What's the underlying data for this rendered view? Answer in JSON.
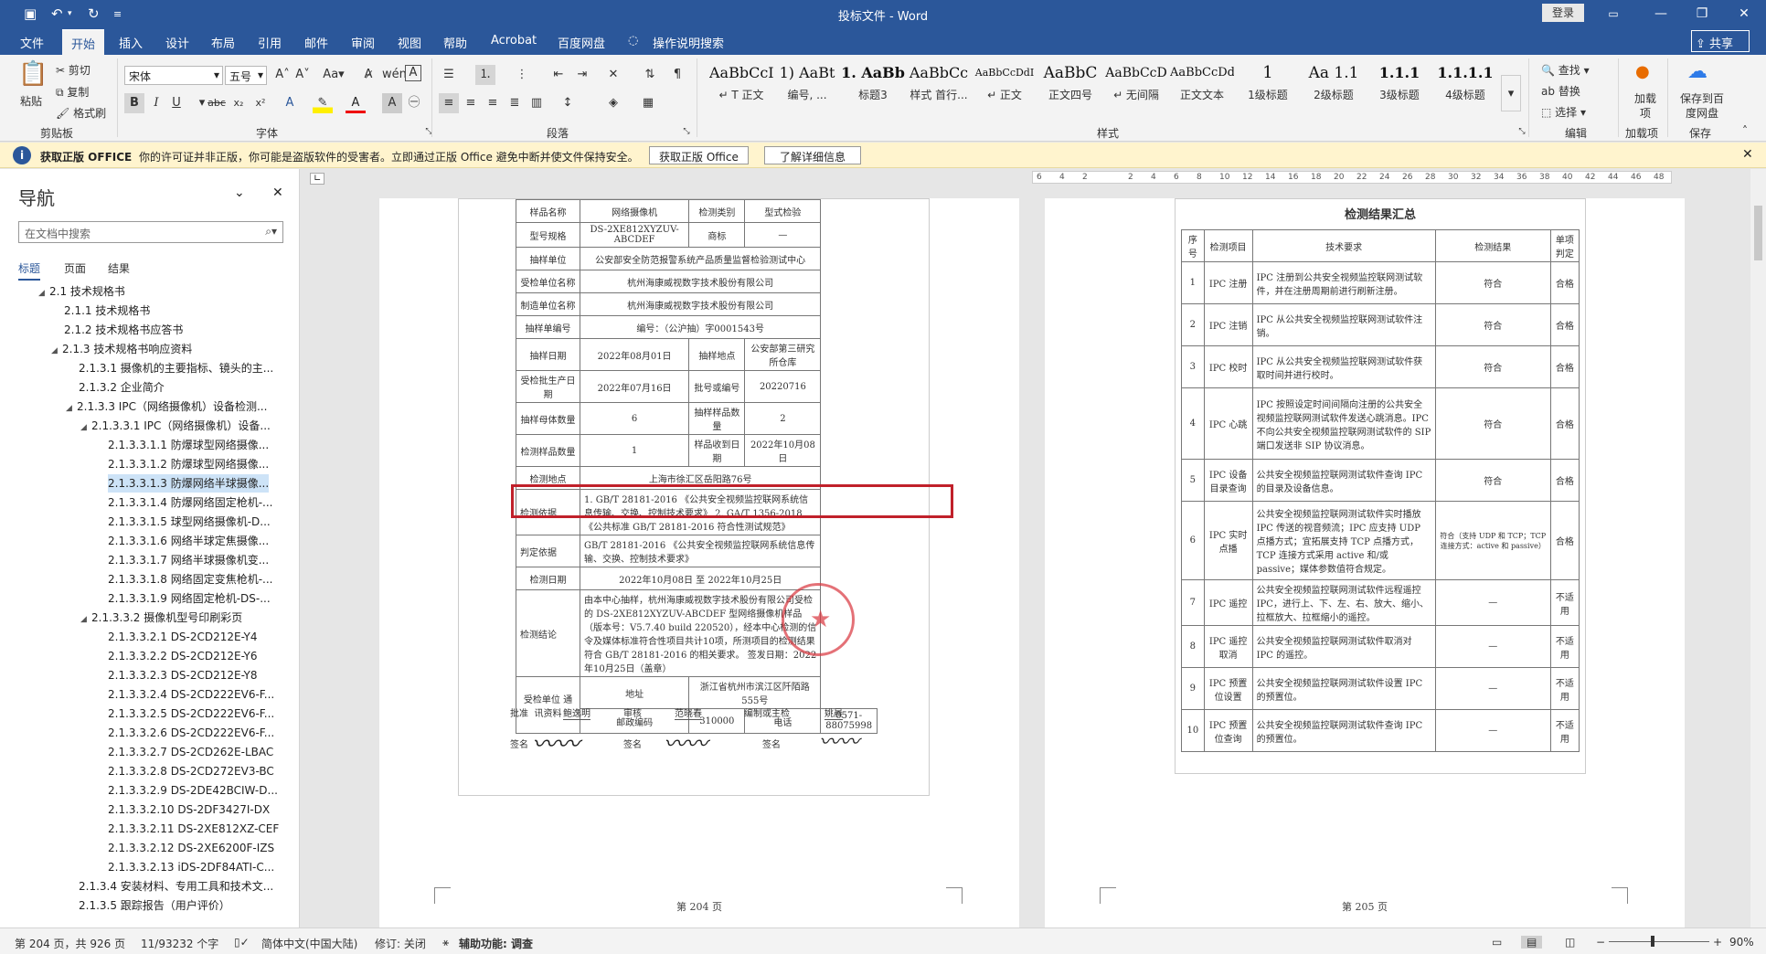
{
  "window": {
    "title": "投标文件 - Word",
    "login_label": "登录",
    "share_label": "共享"
  },
  "tabs": [
    "文件",
    "开始",
    "插入",
    "设计",
    "布局",
    "引用",
    "邮件",
    "审阅",
    "视图",
    "帮助",
    "Acrobat",
    "百度网盘",
    "操作说明搜索"
  ],
  "ribbon": {
    "clipboard": {
      "paste": "粘贴",
      "cut": "剪切",
      "copy": "复制",
      "format_painter": "格式刷",
      "label": "剪贴板"
    },
    "font": {
      "name": "宋体",
      "size": "五号",
      "label": "字体"
    },
    "paragraph_label": "段落",
    "styles": {
      "label": "样式",
      "items": [
        {
          "sample": "AaBbCcI",
          "name": "↵ T 正文"
        },
        {
          "sample": "1) AaBt",
          "name": "编号, ..."
        },
        {
          "sample": "1. AaBb",
          "name": "标题3"
        },
        {
          "sample": "AaBbCc",
          "name": "样式 首行..."
        },
        {
          "sample": "AaBbCcDdI",
          "name": "↵ 正文"
        },
        {
          "sample": "AaBbC",
          "name": "正文四号"
        },
        {
          "sample": "AaBbCcD",
          "name": "↵ 无间隔"
        },
        {
          "sample": "AaBbCcDd",
          "name": "正文文本"
        },
        {
          "sample": "1",
          "name": "1级标题"
        },
        {
          "sample": "Aa 1.1",
          "name": "2级标题"
        },
        {
          "sample": "1.1.1",
          "name": "3级标题"
        },
        {
          "sample": "1.1.1.1",
          "name": "4级标题"
        }
      ]
    },
    "editing": {
      "find": "查找",
      "replace": "替换",
      "select": "选择",
      "label": "编辑"
    },
    "addins": {
      "item": "加载项",
      "label": "加载项"
    },
    "save": {
      "item": "保存到百度网盘",
      "label": "保存"
    }
  },
  "infobar": {
    "title": "获取正版 OFFICE",
    "message": "你的许可证并非正版，你可能是盗版软件的受害者。立即通过正版 Office 避免中断并使文件保持安全。",
    "btn_get": "获取正版 Office",
    "btn_learn": "了解详细信息"
  },
  "nav": {
    "title": "导航",
    "search_placeholder": "在文档中搜索",
    "tabs": [
      "标题",
      "页面",
      "结果"
    ],
    "items": [
      {
        "text": "2.1 技术规格书",
        "level": 2,
        "tri": "◢"
      },
      {
        "text": "2.1.1 技术规格书",
        "level": 3,
        "tri": ""
      },
      {
        "text": "2.1.2 技术规格书应答书",
        "level": 3,
        "tri": ""
      },
      {
        "text": "2.1.3 技术规格书响应资料",
        "level": 3,
        "tri": "◢"
      },
      {
        "text": "2.1.3.1 摄像机的主要指标、镜头的主...",
        "level": 4,
        "tri": ""
      },
      {
        "text": "2.1.3.2 企业简介",
        "level": 4,
        "tri": ""
      },
      {
        "text": "2.1.3.3 IPC（网络摄像机）设备检测...",
        "level": 4,
        "tri": "◢"
      },
      {
        "text": "2.1.3.3.1 IPC（网络摄像机）设备...",
        "level": 5,
        "tri": "◢"
      },
      {
        "text": "2.1.3.3.1.1 防爆球型网络摄像...",
        "level": 6,
        "tri": ""
      },
      {
        "text": "2.1.3.3.1.2 防爆球型网络摄像...",
        "level": 6,
        "tri": ""
      },
      {
        "text": "2.1.3.3.1.3 防爆网络半球摄像...",
        "level": 6,
        "tri": "",
        "selected": true
      },
      {
        "text": "2.1.3.3.1.4 防爆网络固定枪机-...",
        "level": 6,
        "tri": ""
      },
      {
        "text": "2.1.3.3.1.5 球型网络摄像机-D...",
        "level": 6,
        "tri": ""
      },
      {
        "text": "2.1.3.3.1.6 网络半球定焦摄像...",
        "level": 6,
        "tri": ""
      },
      {
        "text": "2.1.3.3.1.7 网络半球摄像机变...",
        "level": 6,
        "tri": ""
      },
      {
        "text": "2.1.3.3.1.8 网络固定变焦枪机-...",
        "level": 6,
        "tri": ""
      },
      {
        "text": "2.1.3.3.1.9 网络固定枪机-DS-...",
        "level": 6,
        "tri": ""
      },
      {
        "text": "2.1.3.3.2 摄像机型号印刷彩页",
        "level": 5,
        "tri": "◢"
      },
      {
        "text": "2.1.3.3.2.1 DS-2CD212E-Y4",
        "level": 6,
        "tri": ""
      },
      {
        "text": "2.1.3.3.2.2 DS-2CD212E-Y6",
        "level": 6,
        "tri": ""
      },
      {
        "text": "2.1.3.3.2.3 DS-2CD212E-Y8",
        "level": 6,
        "tri": ""
      },
      {
        "text": "2.1.3.3.2.4 DS-2CD222EV6-F...",
        "level": 6,
        "tri": ""
      },
      {
        "text": "2.1.3.3.2.5 DS-2CD222EV6-F...",
        "level": 6,
        "tri": ""
      },
      {
        "text": "2.1.3.3.2.6 DS-2CD222EV6-F...",
        "level": 6,
        "tri": ""
      },
      {
        "text": "2.1.3.3.2.7 DS-2CD262E-LBAC",
        "level": 6,
        "tri": ""
      },
      {
        "text": "2.1.3.3.2.8 DS-2CD272EV3-BC",
        "level": 6,
        "tri": ""
      },
      {
        "text": "2.1.3.3.2.9 DS-2DE42BCIW-D...",
        "level": 6,
        "tri": ""
      },
      {
        "text": "2.1.3.3.2.10 DS-2DF3427I-DX",
        "level": 6,
        "tri": ""
      },
      {
        "text": "2.1.3.3.2.11 DS-2XE812XZ-CEF",
        "level": 6,
        "tri": ""
      },
      {
        "text": "2.1.3.3.2.12 DS-2XE6200F-IZS",
        "level": 6,
        "tri": ""
      },
      {
        "text": "2.1.3.3.2.13 iDS-2DF84ATI-C...",
        "level": 6,
        "tri": ""
      },
      {
        "text": "2.1.3.4 安装材料、专用工具和技术文...",
        "level": 4,
        "tri": ""
      },
      {
        "text": "2.1.3.5 跟踪报告（用户评价）",
        "level": 4,
        "tri": ""
      }
    ]
  },
  "ruler": {
    "numbers": [
      "6",
      "4",
      "2",
      "",
      "2",
      "4",
      "6",
      "8",
      "10",
      "12",
      "14",
      "16",
      "18",
      "20",
      "22",
      "24",
      "26",
      "28",
      "30",
      "32",
      "34",
      "36",
      "38",
      "40",
      "42",
      "44",
      "46",
      "48"
    ]
  },
  "page1": {
    "footer": "第 204 页",
    "rows": [
      [
        "样品名称",
        "网络摄像机",
        "检测类别",
        "型式检验"
      ],
      [
        "型号规格",
        "DS-2XE812XYZUV-ABCDEF",
        "商标",
        "—"
      ],
      [
        "抽样单位",
        "公安部安全防范报警系统产品质量监督检验测试中心"
      ],
      [
        "受检单位名称",
        "杭州海康威视数字技术股份有限公司"
      ],
      [
        "制造单位名称",
        "杭州海康威视数字技术股份有限公司"
      ],
      [
        "抽样单编号",
        "编号：（公沪抽）字0001543号"
      ],
      [
        "抽样日期",
        "2022年08月01日",
        "抽样地点",
        "公安部第三研究所仓库"
      ],
      [
        "受检批生产日期",
        "2022年07月16日",
        "批号或编号",
        "20220716"
      ],
      [
        "抽样母体数量",
        "6",
        "抽样样品数量",
        "2"
      ],
      [
        "检测样品数量",
        "1",
        "样品收到日期",
        "2022年10月08日"
      ],
      [
        "检测地点",
        "上海市徐汇区岳阳路76号"
      ],
      [
        "检测依据",
        "1. GB/T 28181-2016 《公共安全视频监控联网系统信息传输、交换、控制技术要求》 2. GA/T 1356-2018 《公共标准 GB/T 28181-2016 符合性测试规范》"
      ],
      [
        "判定依据",
        "GB/T 28181-2016 《公共安全视频监控联网系统信息传输、交换、控制技术要求》"
      ],
      [
        "检测日期",
        "2022年10月08日 至 2022年10月25日"
      ],
      [
        "检测结论",
        "由本中心抽样，杭州海康威视数字技术股份有限公司受检的 DS-2XE812XYZUV-ABCDEF 型网络摄像机样品（版本号：V5.7.40 build 220520），经本中心检测的信令及媒体标准符合性项目共计10项，所测项目的检测结果符合 GB/T 28181-2016 的相关要求。 签发日期：2022年10月25日（盖章）"
      ],
      [
        "受检单位 通讯资料",
        "地址",
        "浙江省杭州市滨江区阡陌路555号"
      ],
      [
        "",
        "邮政编码",
        "310000",
        "电话",
        "0571-88075998"
      ]
    ],
    "signatures": {
      "approve_label": "批准",
      "approve": "鲍逸明",
      "review_label": "审核",
      "review": "范晓春",
      "author_label": "编制或主检",
      "author": "姚晨",
      "sign_label": "签名"
    }
  },
  "page2": {
    "footer": "第 205 页",
    "title": "检测结果汇总",
    "headers": [
      "序号",
      "检测项目",
      "技术要求",
      "检测结果",
      "单项判定"
    ],
    "rows": [
      [
        "1",
        "IPC 注册",
        "IPC 注册到公共安全视频监控联网测试软件，并在注册周期前进行刷新注册。",
        "符合",
        "合格"
      ],
      [
        "2",
        "IPC 注销",
        "IPC 从公共安全视频监控联网测试软件注销。",
        "符合",
        "合格"
      ],
      [
        "3",
        "IPC 校时",
        "IPC 从公共安全视频监控联网测试软件获取时间并进行校时。",
        "符合",
        "合格"
      ],
      [
        "4",
        "IPC 心跳",
        "IPC 按照设定时间间隔向注册的公共安全视频监控联网测试软件发送心跳消息。IPC 不向公共安全视频监控联网测试软件的 SIP 端口发送非 SIP 协议消息。",
        "符合",
        "合格"
      ],
      [
        "5",
        "IPC 设备目录查询",
        "公共安全视频监控联网测试软件查询 IPC 的目录及设备信息。",
        "符合",
        "合格"
      ],
      [
        "6",
        "IPC 实时点播",
        "公共安全视频监控联网测试软件实时播放 IPC 传送的视音频流；IPC 应支持 UDP 点播方式；宜拓展支持 TCP 点播方式，TCP 连接方式采用 active 和/或 passive；媒体参数值符合规定。",
        "符合（支持 UDP 和 TCP；TCP 连接方式：active 和 passive）",
        "合格"
      ],
      [
        "7",
        "IPC 遥控",
        "公共安全视频监控联网测试软件远程遥控 IPC，进行上、下、左、右、放大、缩小、拉框放大、拉框缩小的遥控。",
        "—",
        "不适用"
      ],
      [
        "8",
        "IPC 遥控取消",
        "公共安全视频监控联网测试软件取消对 IPC 的遥控。",
        "—",
        "不适用"
      ],
      [
        "9",
        "IPC 预置位设置",
        "公共安全视频监控联网测试软件设置 IPC 的预置位。",
        "—",
        "不适用"
      ],
      [
        "10",
        "IPC 预置位查询",
        "公共安全视频监控联网测试软件查询 IPC 的预置位。",
        "—",
        "不适用"
      ]
    ]
  },
  "status": {
    "page": "第 204 页，共 926 页",
    "words": "11/93232 个字",
    "lang": "简体中文(中国大陆)",
    "track": "修订: 关闭",
    "access": "辅助功能: 调查",
    "zoom": "90%"
  },
  "colors": {
    "brand": "#2b579a",
    "highlight_box": "#c0202a",
    "stamp": "#d9363e"
  }
}
